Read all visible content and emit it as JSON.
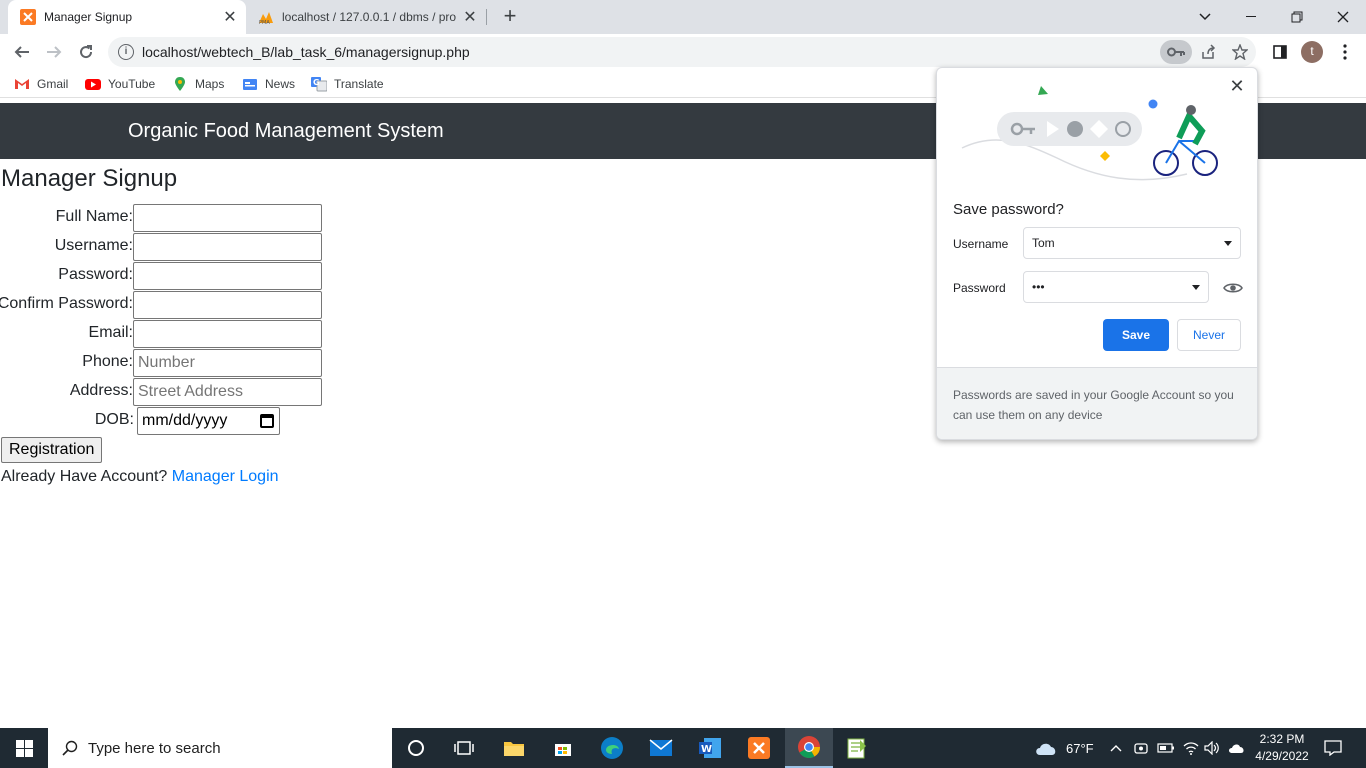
{
  "browser": {
    "tabs": [
      {
        "title": "Manager Signup",
        "active": true
      },
      {
        "title": "localhost / 127.0.0.1 / dbms / pro",
        "active": false
      }
    ],
    "url": "localhost/webtech_B/lab_task_6/managersignup.php",
    "profile_initial": "t",
    "bookmarks": [
      "Gmail",
      "YouTube",
      "Maps",
      "News",
      "Translate"
    ]
  },
  "page": {
    "brand": "Organic Food Management System",
    "title": "Manager Signup",
    "fields": [
      {
        "label": "Full Name:",
        "value": "",
        "placeholder": ""
      },
      {
        "label": "Username:",
        "value": "",
        "placeholder": ""
      },
      {
        "label": "Password:",
        "value": "",
        "placeholder": ""
      },
      {
        "label": "Confirm Password:",
        "value": "",
        "placeholder": ""
      },
      {
        "label": "Email:",
        "value": "",
        "placeholder": ""
      },
      {
        "label": "Phone:",
        "value": "",
        "placeholder": "Number"
      },
      {
        "label": "Address:",
        "value": "",
        "placeholder": "Street Address"
      }
    ],
    "dob_label": "DOB:",
    "dob_value": "mm/dd/yyyy",
    "register_button": "Registration",
    "account_prompt": "Already Have Account?",
    "login_link": "Manager Login"
  },
  "password_popup": {
    "heading": "Save password?",
    "username_label": "Username",
    "username_value": "Tom",
    "password_label": "Password",
    "password_value": "•••",
    "save_label": "Save",
    "never_label": "Never",
    "footer": "Passwords are saved in your Google Account so you can use them on any device"
  },
  "taskbar": {
    "search_placeholder": "Type here to search",
    "temperature": "67°F",
    "time": "2:32 PM",
    "date": "4/29/2022"
  },
  "colors": {
    "navbar": "#343a40",
    "link": "#007bff",
    "google_blue": "#1a73e8",
    "taskbar": "#1f2a33"
  }
}
